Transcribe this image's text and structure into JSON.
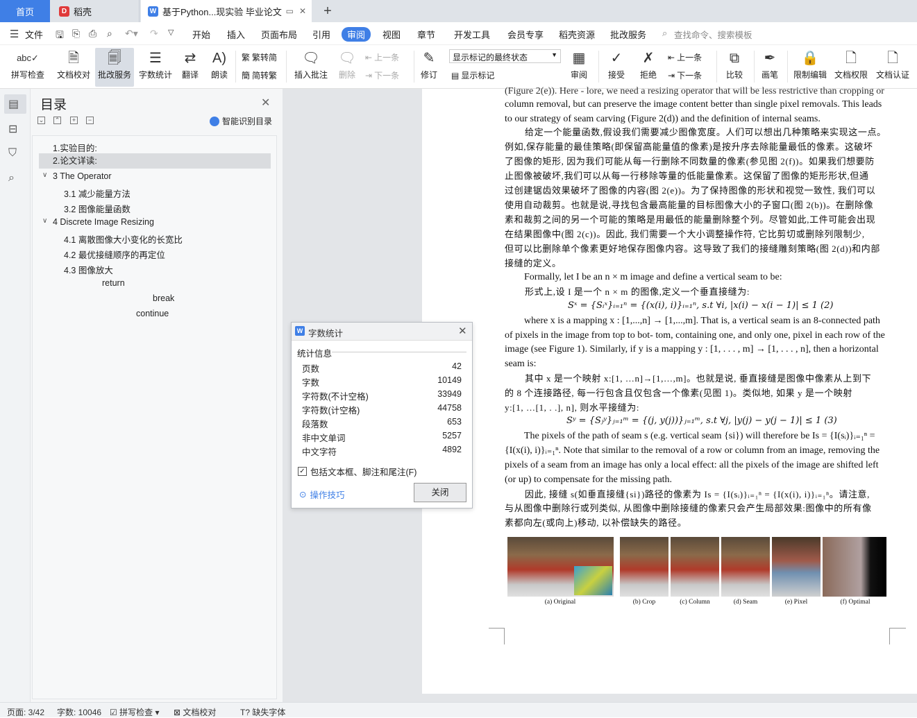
{
  "tabs": {
    "home": "首页",
    "daoke": "稻壳",
    "doc": "基于Python...现实验 毕业论文"
  },
  "menu": {
    "file": "文件",
    "items": [
      "开始",
      "插入",
      "页面布局",
      "引用",
      "审阅",
      "视图",
      "章节",
      "开发工具",
      "会员专享",
      "稻壳资源",
      "批改服务"
    ],
    "active": "审阅",
    "search": "查找命令、搜索模板"
  },
  "ribbon": {
    "spell": "拼写检查",
    "proof": "文档校对",
    "review_service": "批改服务",
    "wordcount": "字数统计",
    "translate": "翻译",
    "read": "朗读",
    "trad_to_simp": "繁转简",
    "simp_to_trad": "简转繁",
    "insert_comment": "插入批注",
    "delete": "删除",
    "prev": "上一条",
    "next": "下一条",
    "revise": "修订",
    "markup_state": "显示标记的最终状态",
    "show_markup": "显示标记",
    "review": "审阅",
    "accept": "接受",
    "reject": "拒绝",
    "prev2": "上一条",
    "next2": "下一条",
    "compare": "比较",
    "ink": "画笔",
    "restrict_edit": "限制编辑",
    "doc_perm": "文档权限",
    "doc_cert": "文档认证"
  },
  "toc": {
    "title": "目录",
    "smart": "智能识别目录",
    "items": [
      "1.实验目的:",
      "2.论文详读:",
      "3 The Operator",
      "3.1 减少能量方法",
      "3.2 图像能量函数",
      "4 Discrete Image Resizing",
      "4.1 离散图像大小变化的长宽比",
      "4.2 最优接缝顺序的再定位",
      "4.3 图像放大",
      "return",
      "break",
      "continue"
    ]
  },
  "document": {
    "lines": [
      "(Figure 2(e)). Here - lore, we need a resizing operator that will be less restrictive than cropping or",
      "column removal, but can preserve the image content better than single pixel removals. This leads",
      "to our strategy of seam carving (Figure 2(d)) and the definition of internal seams.",
      "给定一个能量函数,假设我们需要减少图像宽度。人们可以想出几种策略来实现这一点。",
      "例如,保存能量的最佳策略(即保留高能量值的像素)是按升序去除能量最低的像素。这破坏",
      "了图像的矩形, 因为我们可能从每一行删除不同数量的像素(参见图 2(f))。如果我们想要防",
      "止图像被破坏,我们可以从每一行移除等量的低能量像素。这保留了图像的矩形形状,但通",
      "过创建锯齿效果破坏了图像的内容(图 2(e))。为了保持图像的形状和视觉一致性, 我们可以",
      "使用自动裁剪。也就是说,寻找包含最高能量的目标图像大小的子窗口(图 2(b))。在删除像",
      "素和裁剪之间的另一个可能的策略是用最低的能量删除整个列。尽管如此,工件可能会出现",
      "在结果图像中(图 2(c))。因此, 我们需要一个大小调整操作符, 它比剪切或删除列限制少,",
      "但可以比删除单个像素更好地保存图像内容。这导致了我们的接缝雕刻策略(图 2(d))和内部",
      "接缝的定义。",
      "Formally, let I be an n × m image and define a vertical seam to be:",
      "形式上,设 I 是一个 n × m 的图像,定义一个垂直接缝为:",
      "Sˣ = {Sᵢˣ}ᵢ₌₁ⁿ = {(x(i), i)}ᵢ₌₁ⁿ, s.t ∀i, |x(i) − x(i − 1)| ≤ 1    (2)",
      "where x is a mapping x : [1,...,n] → [1,...,m]. That is, a vertical seam is an 8-connected path",
      "of pixels in the image from top to bot- tom, containing one, and only one, pixel in each row of the",
      "image (see Figure 1). Similarly, if y is a mapping y : [1, . . . , m] → [1, . . . , n], then a horizontal",
      "seam is:",
      "其中 x 是一个映射 x:[1, …n]→[1,…,m]。也就是说, 垂直接缝是图像中像素从上到下",
      "的 8 个连接路径, 每一行包含且仅包含一个像素(见图 1)。类似地, 如果 y 是一个映射",
      "y:[1, …[1,  . .],  n], 则水平接缝为:",
      "Sʸ = {Sⱼʸ}ⱼ₌₁ᵐ = {(j, y(j))}ⱼ₌₁ᵐ, s.t ∀j, |y(j) − y(j − 1)| ≤ 1    (3)",
      "The pixels of the path of seam s (e.g. vertical seam {si}) will therefore be  Is = {I(sᵢ)}ᵢ₌₁ⁿ =",
      "{I(x(i), i)}ᵢ₌₁ⁿ. Note that similar to the removal of a row or column from an image, removing the",
      "pixels of a seam from an image has only a local effect: all the pixels of the image are shifted left",
      "(or up) to compensate  for the missing path.",
      "因此, 接缝 s(如垂直接缝{si})路径的像素为  Is = {I(sᵢ)}ᵢ₌₁ⁿ = {I(x(i), i)}ᵢ₌₁ⁿ。请注意,",
      "与从图像中删除行或列类似, 从图像中删除接缝的像素只会产生局部效果:图像中的所有像",
      "素都向左(或向上)移动, 以补偿缺失的路径。"
    ],
    "figure_captions": [
      "(a) Original",
      "(b) Crop",
      "(c) Column",
      "(d) Seam",
      "(e) Pixel",
      "(f) Optimal"
    ]
  },
  "dialog": {
    "title": "字数统计",
    "section": "统计信息",
    "rows": [
      {
        "label": "页数",
        "value": "42"
      },
      {
        "label": "字数",
        "value": "10149"
      },
      {
        "label": "字符数(不计空格)",
        "value": "33949"
      },
      {
        "label": "字符数(计空格)",
        "value": "44758"
      },
      {
        "label": "段落数",
        "value": "653"
      },
      {
        "label": "非中文单词",
        "value": "5257"
      },
      {
        "label": "中文字符",
        "value": "4892"
      }
    ],
    "include": "包括文本框、脚注和尾注(F)",
    "tips": "操作技巧",
    "close": "关闭"
  },
  "status": {
    "page": "页面: 3/42",
    "words": "字数: 10046",
    "spell": "拼写检查",
    "proof": "文档校对",
    "missing_font": "缺失字体"
  },
  "colors": {
    "accent": "#3f7fe6"
  }
}
